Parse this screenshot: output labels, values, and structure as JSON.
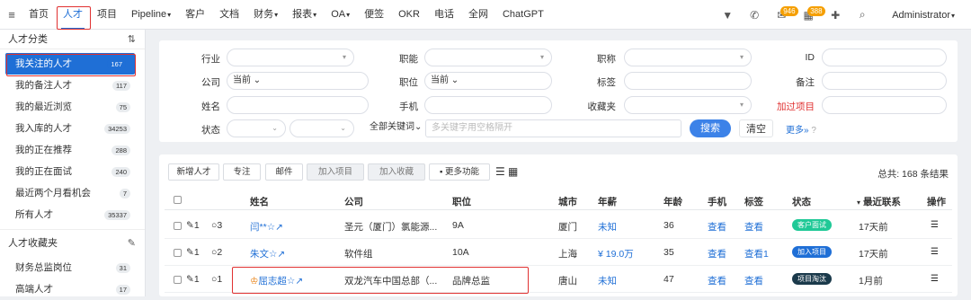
{
  "nav": {
    "items": [
      {
        "label": "首页"
      },
      {
        "label": "人才"
      },
      {
        "label": "项目"
      },
      {
        "label": "Pipeline"
      },
      {
        "label": "客户"
      },
      {
        "label": "文档"
      },
      {
        "label": "财务"
      },
      {
        "label": "报表"
      },
      {
        "label": "OA"
      },
      {
        "label": "便签"
      },
      {
        "label": "OKR"
      },
      {
        "label": "电话"
      },
      {
        "label": "全网"
      },
      {
        "label": "ChatGPT"
      }
    ],
    "badge_mail": "946",
    "badge_calendar": "388",
    "user": "Administrator"
  },
  "sidebar": {
    "section1_title": "人才分类",
    "items": [
      {
        "label": "我关注的人才",
        "count": "167"
      },
      {
        "label": "我的备注人才",
        "count": "117"
      },
      {
        "label": "我的最近浏览",
        "count": "75"
      },
      {
        "label": "我入库的人才",
        "count": "34253"
      },
      {
        "label": "我的正在推荐",
        "count": "288"
      },
      {
        "label": "我的正在面试",
        "count": "240"
      },
      {
        "label": "最近两个月看机会",
        "count": "7"
      },
      {
        "label": "所有人才",
        "count": "35337"
      }
    ],
    "section2_title": "人才收藏夹",
    "fav_items": [
      {
        "label": "财务总监岗位",
        "count": "31"
      },
      {
        "label": "高端人才",
        "count": "17"
      }
    ]
  },
  "filter": {
    "industry": "行业",
    "function": "职能",
    "title": "职称",
    "id": "ID",
    "company": "公司",
    "company_mode": "当前",
    "position": "职位",
    "position_mode": "当前",
    "tags": "标签",
    "note": "备注",
    "name": "姓名",
    "phone": "手机",
    "favorites": "收藏夹",
    "added_project": "加过项目",
    "status": "状态",
    "keyword_mode": "全部关键词",
    "keyword_placeholder": "多关键字用空格隔开",
    "search": "搜索",
    "clear": "清空",
    "more": "更多"
  },
  "toolbar": {
    "new": "新增人才",
    "follow": "专注",
    "mail": "邮件",
    "add_project": "加入项目",
    "add_favorite": "加入收藏",
    "more_functions": "更多功能",
    "total": "总共: 168 条结果"
  },
  "table": {
    "headers": [
      "姓名",
      "公司",
      "职位",
      "城市",
      "年薪",
      "年龄",
      "手机",
      "标签",
      "状态",
      "最近联系",
      "操作"
    ],
    "rows": [
      {
        "attach": "1",
        "comments": "3",
        "name": "闫**",
        "company": "圣元（厦门）氯能源...",
        "position": "9A",
        "city": "厦门",
        "salary": "未知",
        "age": "36",
        "phone": "查看",
        "tag": "查看",
        "status": "客户面试",
        "status_color": "#20c997",
        "last": "17天前"
      },
      {
        "attach": "1",
        "comments": "2",
        "name": "朱文",
        "company": "软件组",
        "position": "10A",
        "city": "上海",
        "salary": "¥ 19.0万",
        "age": "35",
        "phone": "查看",
        "tag": "查看1",
        "status": "加入项目",
        "status_color": "#1f6fd6",
        "last": "17天前"
      },
      {
        "attach": "1",
        "comments": "1",
        "name": "屈志超",
        "company": "双龙汽车中国总部（...",
        "position": "品牌总监",
        "city": "唐山",
        "salary": "未知",
        "age": "47",
        "phone": "查看",
        "tag": "查看",
        "status": "项目淘汰",
        "status_color": "#1b3a4b",
        "last": "1月前"
      }
    ]
  }
}
